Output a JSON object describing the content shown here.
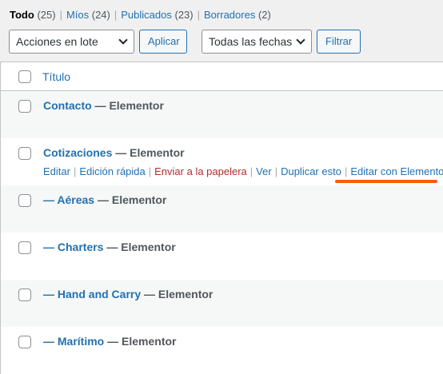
{
  "filters": [
    {
      "label": "Todo",
      "count": "(25)",
      "current": true
    },
    {
      "label": "Míos",
      "count": "(24)",
      "current": false
    },
    {
      "label": "Publicados",
      "count": "(23)",
      "current": false
    },
    {
      "label": "Borradores",
      "count": "(2)",
      "current": false
    }
  ],
  "filter_separator": "|",
  "tablenav": {
    "bulk_actions": "Acciones en lote",
    "apply_label": "Aplicar",
    "dates": "Todas las fechas",
    "filter_label": "Filtrar"
  },
  "table": {
    "column_title": "Título",
    "rows": [
      {
        "title": "Contacto",
        "state": " — Elementor"
      },
      {
        "title": "Cotizaciones",
        "state": " — Elementor"
      },
      {
        "title": "— Aéreas",
        "state": " — Elementor"
      },
      {
        "title": "— Charters",
        "state": " — Elementor"
      },
      {
        "title": "— Hand and Carry",
        "state": " — Elementor"
      },
      {
        "title": "— Marítimo",
        "state": " — Elementor"
      }
    ],
    "row_actions": {
      "edit": "Editar",
      "quick_edit": "Edición rápida",
      "trash": "Enviar a la papelera",
      "view": "Ver",
      "duplicate": "Duplicar esto",
      "elementor": "Editar con Elementor"
    }
  },
  "colors": {
    "link": "#2271b1",
    "trash": "#b32d2e",
    "annotation": "#ff5c00"
  }
}
